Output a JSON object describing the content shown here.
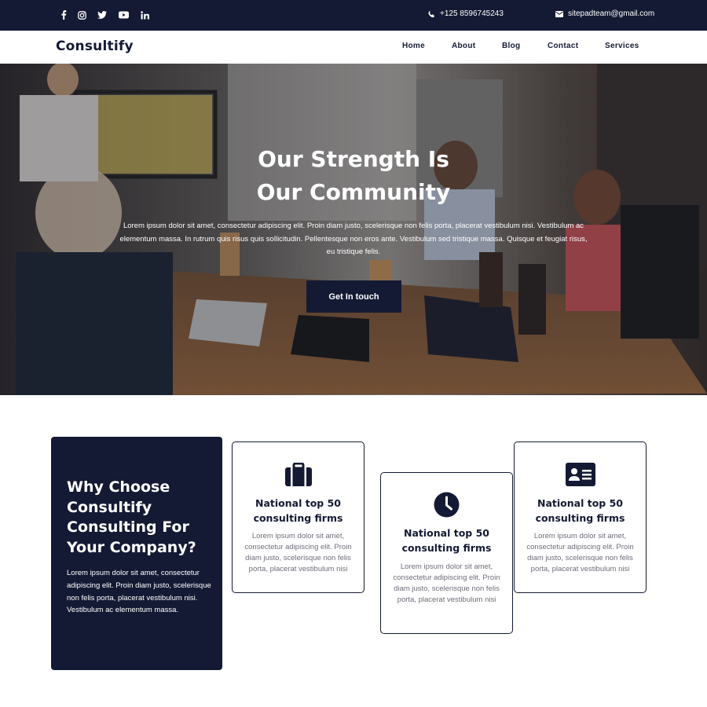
{
  "colors": {
    "primary": "#141a33",
    "white": "#ffffff",
    "muted_text": "#6d6f7a"
  },
  "topbar": {
    "social_icons": [
      "facebook-icon",
      "instagram-icon",
      "twitter-icon",
      "youtube-icon",
      "linkedin-icon"
    ],
    "phone": "+125 8596745243",
    "email": "sitepadteam@gmail.com"
  },
  "navbar": {
    "brand": "Consultify",
    "links": [
      "Home",
      "About",
      "Blog",
      "Contact",
      "Services"
    ]
  },
  "hero": {
    "title_line1": "Our Strength Is",
    "title_line2": "Our Community",
    "text": "Lorem ipsum dolor sit amet, consectetur adipiscing elit. Proin diam justo, scelerisque non felis porta, placerat vestibulum nisi. Vestibulum ac elementum massa. In rutrum quis risus quis sollicitudin. Pellentesque non eros ante. Vestibulum sed tristique massa. Quisque et feugiat risus, eu tristique felis.",
    "button": "Get In touch"
  },
  "why": {
    "title": "Why Choose Consultify Consulting For Your Company?",
    "text": "Lorem ipsum dolor sit amet, consectetur adipiscing elit. Proin diam justo, scelerisque non felis porta, placerat vestibulum nisi. Vestibulum ac elementum massa."
  },
  "features": [
    {
      "icon": "briefcase-icon",
      "title": "National top 50 consulting firms",
      "text": "Lorem ipsum dolor sit amet, consectetur adipiscing elit. Proin diam justo, scelerisque non felis porta, placerat vestibulum nisi"
    },
    {
      "icon": "clock-icon",
      "title": "National top 50 consulting firms",
      "text": "Lorem ipsum dolor sit amet, consectetur adipiscing elit. Proin diam justo, scelerisque non felis porta, placerat vestibulum nisi"
    },
    {
      "icon": "id-card-icon",
      "title": "National top 50 consulting firms",
      "text": "Lorem ipsum dolor sit amet, consectetur adipiscing elit. Proin diam justo, scelerisque non felis porta, placerat vestibulum nisi"
    }
  ]
}
